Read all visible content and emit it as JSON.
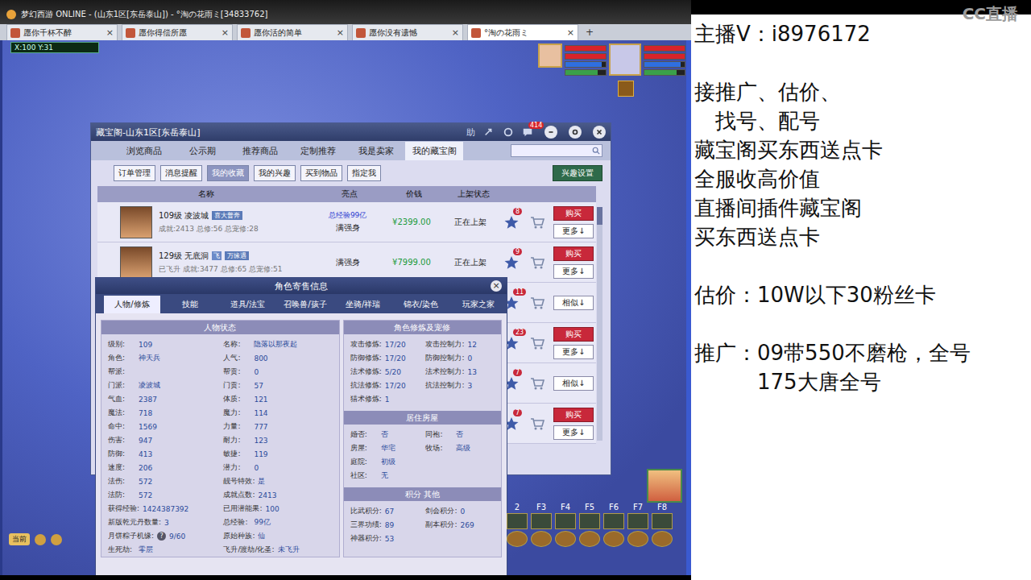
{
  "window": {
    "title": "梦幻西游 ONLINE - (山东1区[东岳泰山]) - °淘の花雨ミ[34833762]"
  },
  "tabs": [
    {
      "label": "愿你千杯不醉",
      "selected": false
    },
    {
      "label": "愿你得偿所愿",
      "selected": false
    },
    {
      "label": "愿你活的简单",
      "selected": false
    },
    {
      "label": "愿你没有遗憾",
      "selected": false
    },
    {
      "label": "°淘の花雨ミ",
      "selected": true
    }
  ],
  "tab_close": "×",
  "tab_add": "+",
  "coords": "X:100 Y:31",
  "hud_bars": [
    {
      "level": 1,
      "color": "#d8232a"
    },
    {
      "level": 1,
      "color": "#d8232a"
    },
    {
      "level": 0.9,
      "color": "#2f6fe0"
    },
    {
      "level": 0.8,
      "color": "#3aa04a"
    }
  ],
  "cbg": {
    "title": "藏宝阁-山东1区[东岳泰山]",
    "help": "助",
    "badge": "414",
    "tabs": [
      {
        "label": "浏览商品",
        "selected": false
      },
      {
        "label": "公示期",
        "selected": false
      },
      {
        "label": "推荐商品",
        "selected": false
      },
      {
        "label": "定制推荐",
        "selected": false
      },
      {
        "label": "我是卖家",
        "selected": false
      },
      {
        "label": "我的藏宝阁",
        "selected": true
      }
    ],
    "subtabs": [
      {
        "label": "订单管理",
        "selected": false
      },
      {
        "label": "消息提醒",
        "selected": false
      },
      {
        "label": "我的收藏",
        "selected": true
      },
      {
        "label": "我的兴趣",
        "selected": false
      },
      {
        "label": "买到物品",
        "selected": false
      },
      {
        "label": "指定我",
        "selected": false
      }
    ],
    "interest_button": "兴趣设置",
    "columns": [
      "名称",
      "亮点",
      "价钱",
      "上架状态"
    ],
    "rows": [
      {
        "name": "109级 凌波城",
        "flag": "",
        "tag": "喜大普奔",
        "stats": "成就:2413 总修:56 总宠修:28",
        "exp": "总经验99亿",
        "highlight": "满强身",
        "price": "¥2399.00",
        "status": "正在上架",
        "badge": "8",
        "actions": [
          {
            "label": "购买",
            "kind": "buy"
          },
          {
            "label": "更多↓",
            "kind": "more"
          }
        ]
      },
      {
        "name": "129级 无底洞",
        "flag": "飞",
        "tag": "万缘遇",
        "stats": "已飞升 成就:3477 总修:65 总宠修:51",
        "exp": "",
        "highlight": "满强身",
        "price": "¥7999.00",
        "status": "正在上架",
        "badge": "9",
        "actions": [
          {
            "label": "购买",
            "kind": "buy"
          },
          {
            "label": "更多↓",
            "kind": "more"
          }
        ]
      },
      {
        "name": "",
        "flag": "",
        "tag": "",
        "stats": "",
        "exp": "",
        "highlight": "",
        "price": "",
        "status": "",
        "badge": "11",
        "actions": [
          {
            "label": "相似↓",
            "kind": "more"
          }
        ]
      },
      {
        "name": "",
        "flag": "",
        "tag": "",
        "stats": "",
        "exp": "",
        "highlight": "",
        "price": "",
        "status": "",
        "badge": "23",
        "actions": [
          {
            "label": "购买",
            "kind": "buy"
          },
          {
            "label": "更多↓",
            "kind": "more"
          }
        ]
      },
      {
        "name": "",
        "flag": "",
        "tag": "",
        "stats": "",
        "exp": "",
        "highlight": "",
        "price": "",
        "status": "",
        "badge": "7",
        "actions": [
          {
            "label": "相似↓",
            "kind": "more"
          }
        ]
      },
      {
        "name": "",
        "flag": "",
        "tag": "",
        "stats": "",
        "exp": "",
        "highlight": "",
        "price": "",
        "status": "",
        "badge": "7",
        "actions": [
          {
            "label": "购买",
            "kind": "buy"
          },
          {
            "label": "更多↓",
            "kind": "more"
          }
        ]
      }
    ]
  },
  "role": {
    "title": "角色寄售信息",
    "close": "×",
    "tabs": [
      {
        "label": "人物/修炼",
        "selected": true
      },
      {
        "label": "技能",
        "selected": false
      },
      {
        "label": "道具/法宝",
        "selected": false
      },
      {
        "label": "召唤兽/孩子",
        "selected": false
      },
      {
        "label": "坐骑/祥瑞",
        "selected": false
      },
      {
        "label": "锦衣/染色",
        "selected": false
      },
      {
        "label": "玩家之家",
        "selected": false
      }
    ],
    "status_title": "人物状态",
    "status": [
      [
        {
          "label": "级别:",
          "value": "109",
          "help": ""
        },
        {
          "label": "名称:",
          "value": "隐落以那夜起",
          "help": ""
        }
      ],
      [
        {
          "label": "角色:",
          "value": "神天兵",
          "help": ""
        },
        {
          "label": "人气:",
          "value": "800",
          "help": ""
        }
      ],
      [
        {
          "label": "帮派:",
          "value": "",
          "help": ""
        },
        {
          "label": "帮贡:",
          "value": "0",
          "help": ""
        }
      ],
      [
        {
          "label": "门派:",
          "value": "凌波城",
          "help": ""
        },
        {
          "label": "门贡:",
          "value": "57",
          "help": ""
        }
      ],
      [
        {
          "label": "气血:",
          "value": "2387",
          "help": ""
        },
        {
          "label": "体质:",
          "value": "121",
          "help": ""
        }
      ],
      [
        {
          "label": "魔法:",
          "value": "718",
          "help": ""
        },
        {
          "label": "魔力:",
          "value": "114",
          "help": ""
        }
      ],
      [
        {
          "label": "命中:",
          "value": "1569",
          "help": ""
        },
        {
          "label": "力量:",
          "value": "777",
          "help": ""
        }
      ],
      [
        {
          "label": "伤害:",
          "value": "947",
          "help": ""
        },
        {
          "label": "耐力:",
          "value": "123",
          "help": ""
        }
      ],
      [
        {
          "label": "防御:",
          "value": "413",
          "help": ""
        },
        {
          "label": "敏捷:",
          "value": "119",
          "help": ""
        }
      ],
      [
        {
          "label": "速度:",
          "value": "206",
          "help": ""
        },
        {
          "label": "潜力:",
          "value": "0",
          "help": ""
        }
      ],
      [
        {
          "label": "法伤:",
          "value": "572",
          "help": ""
        },
        {
          "label": "靓号特效:",
          "value": "是",
          "help": ""
        }
      ],
      [
        {
          "label": "法防:",
          "value": "572",
          "help": ""
        },
        {
          "label": "成就点数:",
          "value": "2413",
          "help": ""
        }
      ],
      [
        {
          "label": "获得经验:",
          "value": "1424387392",
          "help": ""
        },
        {
          "label": "已用潜能果:",
          "value": "100",
          "help": ""
        }
      ],
      [
        {
          "label": "新版乾元丹数量:",
          "value": "3",
          "help": ""
        },
        {
          "label": "总经验:",
          "value": "99亿",
          "help": ""
        }
      ],
      [
        {
          "label": "月饼粽子机缘:",
          "value": "9/60",
          "help": "?"
        },
        {
          "label": "原始种族:",
          "value": "仙",
          "help": ""
        }
      ],
      [
        {
          "label": "生死劫:",
          "value": "零层",
          "help": ""
        },
        {
          "label": "飞升/渡劫/化圣:",
          "value": "未飞升",
          "help": ""
        }
      ]
    ],
    "cultivation_title": "角色修炼及宠修",
    "cultivation": [
      [
        {
          "label": "攻击修炼:",
          "value": "17/20"
        },
        {
          "label": "攻击控制力:",
          "value": "12"
        }
      ],
      [
        {
          "label": "防御修炼:",
          "value": "17/20"
        },
        {
          "label": "防御控制力:",
          "value": "0"
        }
      ],
      [
        {
          "label": "法术修炼:",
          "value": "5/20"
        },
        {
          "label": "法术控制力:",
          "value": "13"
        }
      ],
      [
        {
          "label": "抗法修炼:",
          "value": "17/20"
        },
        {
          "label": "抗法控制力:",
          "value": "3"
        }
      ],
      [
        {
          "label": "猎术修炼:",
          "value": "1"
        }
      ]
    ],
    "house_title": "居住房屋",
    "house": [
      [
        {
          "label": "婚否:",
          "value": "否"
        },
        {
          "label": "同袍:",
          "value": "否"
        }
      ],
      [
        {
          "label": "房屋:",
          "value": "华宅"
        },
        {
          "label": "牧场:",
          "value": "高级"
        }
      ],
      [
        {
          "label": "庭院:",
          "value": "初级"
        }
      ],
      [
        {
          "label": "社区:",
          "value": "无"
        }
      ]
    ],
    "score_title": "积分 其他",
    "score": [
      [
        {
          "label": "比武积分:",
          "value": "67"
        },
        {
          "label": "剑会积分:",
          "value": "0"
        }
      ],
      [
        {
          "label": "三界功绩:",
          "value": "89"
        },
        {
          "label": "副本积分:",
          "value": "269"
        }
      ],
      [
        {
          "label": "神器积分:",
          "value": "53"
        }
      ]
    ]
  },
  "toolbar": {
    "keys": [
      "2",
      "F3",
      "F4",
      "F5",
      "F6",
      "F7",
      "F8"
    ],
    "channel": "当前"
  },
  "stream_panel": {
    "watermark": "CC直播",
    "groups": [
      {
        "lines": [
          {
            "text": "主播V：i8976172",
            "kind": "main"
          }
        ]
      },
      {
        "lines": [
          {
            "text": "接推广、估价、",
            "kind": "main"
          },
          {
            "text": "找号、配号",
            "kind": "cont"
          },
          {
            "text": "藏宝阁买东西送点卡",
            "kind": "main"
          },
          {
            "text": "全服收高价值",
            "kind": "main"
          },
          {
            "text": "直播间插件藏宝阁",
            "kind": "main"
          },
          {
            "text": "买东西送点卡",
            "kind": "main"
          }
        ]
      },
      {
        "lines": [
          {
            "text": "估价：10W以下30粉丝卡",
            "kind": "main"
          }
        ]
      },
      {
        "lines": [
          {
            "text": "推广：09带550不磨枪，全号",
            "kind": "main"
          },
          {
            "text": "175大唐全号",
            "kind": "indent"
          }
        ]
      }
    ]
  }
}
